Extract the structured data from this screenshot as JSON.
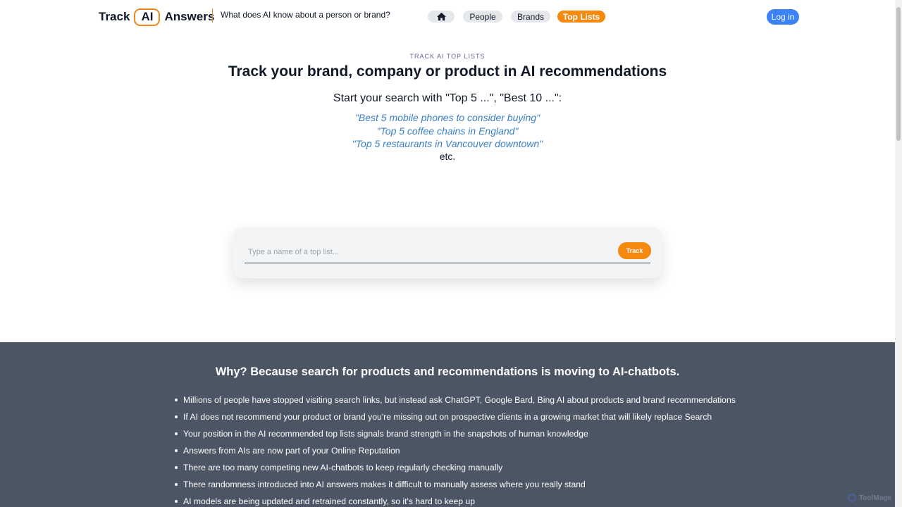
{
  "header": {
    "logo_left": "Track",
    "logo_boxed": "AI",
    "logo_right": "Answers",
    "tagline": "What does AI know about a person or brand?",
    "nav": {
      "home_icon": "home-icon",
      "people": "People",
      "brands": "Brands",
      "top_lists": "Top Lists",
      "active": "Top Lists"
    },
    "login": "Log in"
  },
  "hero": {
    "eyebrow": "TRACK AI TOP LISTS",
    "title": "Track your brand, company or product in AI recommendations",
    "subtitle": "Start your search with \"Top 5 ...\", \"Best 10 ...\":",
    "examples": [
      "\"Best 5 mobile phones to consider buying\"",
      "\"Top 5 coffee chains in England\"",
      "\"Top 5 restaurants in Vancouver downtown\""
    ],
    "etc": "etc."
  },
  "search": {
    "placeholder": "Type a name of a top list...",
    "value": "",
    "button": "Track"
  },
  "why": {
    "title": "Why? Because search for products and recommendations is moving to AI-chatbots.",
    "items": [
      "Millions of people have stopped visiting search links, but instead ask ChatGPT, Google Bard, Bing AI about products and brand recommendations",
      "If AI does not recommend your product or brand you're missing out on prospective clients in a growing market that will likely replace Search",
      "Your position in the AI recommended top lists signals brand strength in the snapshots of human knowledge",
      "Answers from AIs are now part of your Online Reputation",
      "There are too many competing new AI-chatbots to keep regularly checking manually",
      "There randomness introduced into AI answers makes it difficult to manually assess where you really stand",
      "AI models are being updated and retrained constantly, so it's hard to keep up"
    ]
  },
  "watermark": "ToolMage",
  "colors": {
    "accent_orange": "#f5880f",
    "login_blue": "#3b82f6",
    "example_blue": "#3b7fc4",
    "why_bg": "#4b5563"
  }
}
